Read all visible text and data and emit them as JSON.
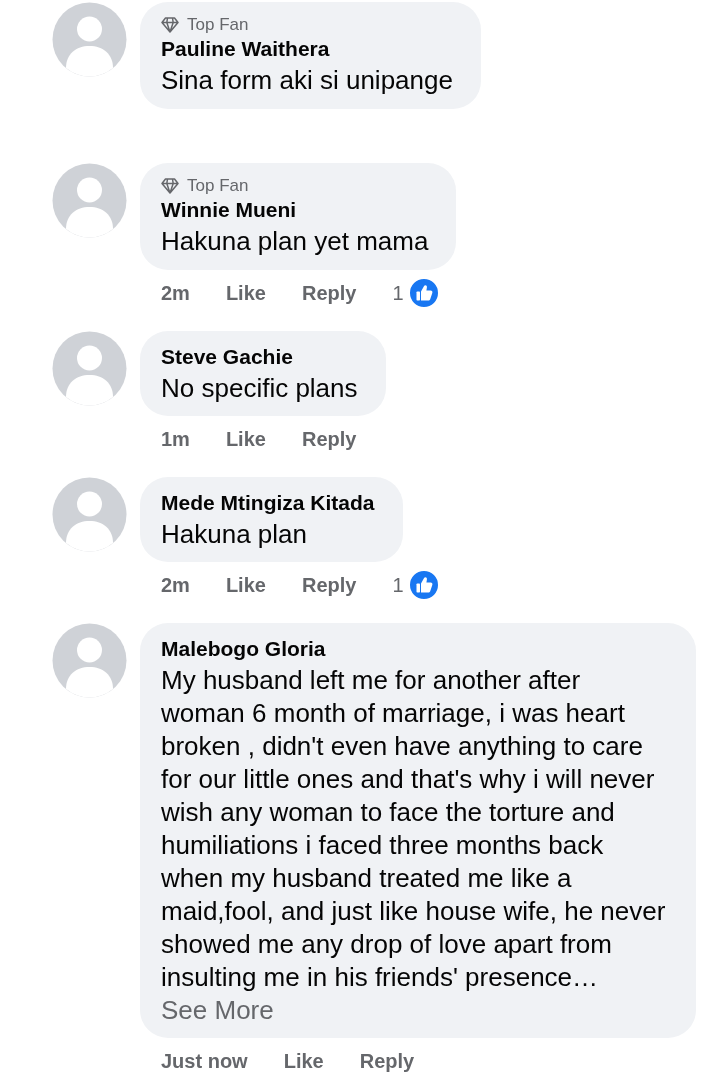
{
  "comments": [
    {
      "badge": "Top Fan",
      "author": "Pauline Waithera",
      "text": "Sina form aki si unipange"
    },
    {
      "badge": "Top Fan",
      "author": "Winnie Mueni",
      "text": "Hakuna plan yet mama",
      "time": "2m",
      "actions": [
        "Like",
        "Reply"
      ],
      "reaction_count": "1"
    },
    {
      "author": "Steve Gachie",
      "text": "No specific plans",
      "time": "1m",
      "actions": [
        "Like",
        "Reply"
      ]
    },
    {
      "author": "Mede Mtingiza Kitada",
      "text": "Hakuna plan",
      "time": "2m",
      "actions": [
        "Like",
        "Reply"
      ],
      "reaction_count": "1"
    },
    {
      "author": "Malebogo Gloria",
      "text": "My husband left me for another after woman 6 month of marriage, i was heart broken , didn't even have anything to care for our little ones and that's why i will never wish any woman to face the torture and humiliations i faced three months back when my husband treated me like a maid,fool, and just like house wife, he never showed me any drop of love apart from insulting me in his friends' presence…",
      "see_more": "See More",
      "time": "Just now",
      "actions": [
        "Like",
        "Reply"
      ]
    }
  ]
}
